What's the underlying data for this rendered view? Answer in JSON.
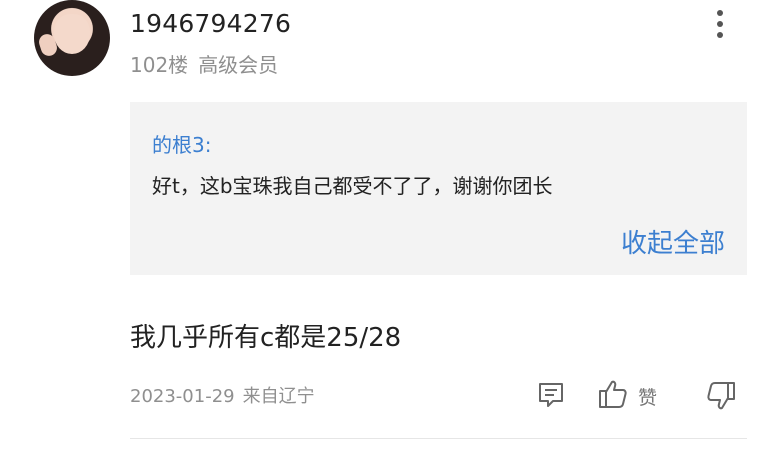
{
  "post": {
    "username": "1946794276",
    "floor": "102楼",
    "member_level": "高级会员",
    "quote": {
      "author": "的根3:",
      "text": "好t，这b宝珠我自己都受不了了，谢谢你团长",
      "collapse_label": "收起全部"
    },
    "content": "我几乎所有c都是25/28",
    "date": "2023-01-29",
    "location": "来自辽宁",
    "like_label": "赞"
  },
  "icons": {
    "avatar": "user-avatar",
    "more": "more-vertical-icon",
    "comment": "comment-icon",
    "like": "thumbs-up-icon",
    "dislike": "thumbs-down-icon"
  },
  "colors": {
    "link": "#3c7fd0",
    "muted": "#8f8f8f",
    "quote_bg": "#f3f3f3"
  }
}
